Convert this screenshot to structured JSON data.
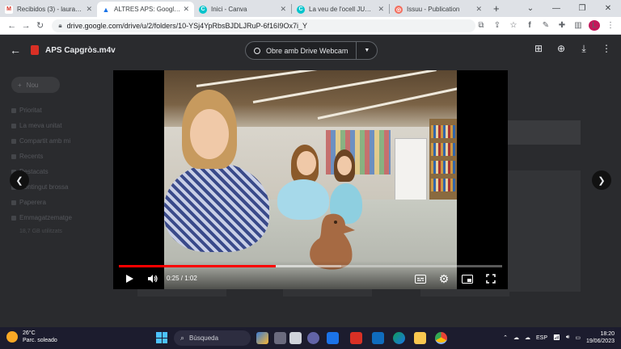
{
  "browser": {
    "tabs": [
      {
        "title": "Recibidos (3) - laurasafo@",
        "favicon": "gmail-icon",
        "color": "#d93025",
        "glyph": "M",
        "active": false
      },
      {
        "title": "ALTRES APS: Google Drive",
        "favicon": "drive-icon",
        "color": "#1a73e8",
        "glyph": "▲",
        "active": true
      },
      {
        "title": "Inici - Canva",
        "favicon": "canva-icon",
        "color": "#00c4cc",
        "glyph": "C",
        "active": false
      },
      {
        "title": "La veu de l'ocell JUNY 20",
        "favicon": "canva-icon",
        "color": "#00c4cc",
        "glyph": "C",
        "active": false
      },
      {
        "title": "Issuu - Publication",
        "favicon": "issuu-icon",
        "color": "#f36d5d",
        "glyph": "◎",
        "active": false
      }
    ],
    "url": "drive.google.com/drive/u/2/folders/10-YSj4YpRbsBJDLJRuP-6f16I9Ox7i_Y",
    "profile_initial": "L"
  },
  "drive": {
    "new_label": "Nou",
    "sidebar": [
      "Prioritat",
      "La meva unitat",
      "Compartit amb mi",
      "Recents",
      "Destacats",
      "Contingut brossa",
      "Paperera",
      "Emmagatzematge"
    ],
    "storage_text": "18,7 GB utilitzats"
  },
  "viewer": {
    "file_name": "APS Capgròs.m4v",
    "open_with_label": "Obre amb Drive Webcam"
  },
  "video": {
    "current_time": "0:25",
    "duration": "1:02",
    "time_text": "0:25 / 1:02",
    "progress": 0.41,
    "buffered": 0.58
  },
  "taskbar": {
    "weather_temp": "26°C",
    "weather_desc": "Parc. soleado",
    "search_label": "Búsqueda",
    "lang": "ESP",
    "time": "18:20",
    "date": "19/06/2023"
  },
  "colors": {
    "accent_red": "#ff0000",
    "taskbar_bg": "#1c1c2e"
  }
}
